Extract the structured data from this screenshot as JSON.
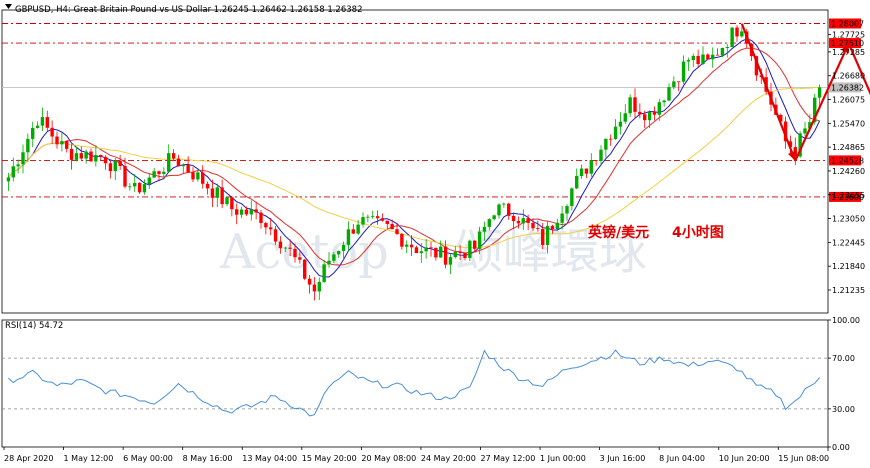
{
  "chart_data": [
    {
      "type": "candlestick",
      "title": "GBPUSD, H4: Great Britain Pound vs US Dollar",
      "ohlc_readout": [
        "1.26245",
        "1.26462",
        "1.26158",
        "1.26382"
      ],
      "ylim": [
        1.2065,
        1.2835
      ],
      "y_ticks": [
        "1.27725",
        "1.27285",
        "1.26680",
        "1.26075",
        "1.25470",
        "1.24865",
        "1.24260",
        "1.23655",
        "1.23050",
        "1.22445",
        "1.21840",
        "1.21235"
      ],
      "current_price": "1.26382",
      "levels": [
        {
          "label": "1.28007",
          "value": 1.28007
        },
        {
          "label": "1.27510",
          "value": 1.2751
        },
        {
          "label": "1.24528",
          "value": 1.24528
        },
        {
          "label": "1.23600",
          "value": 1.236
        }
      ],
      "x_labels": [
        "28 Apr 2020",
        "1 May 12:00",
        "6 May 00:00",
        "8 May 16:00",
        "13 May 04:00",
        "15 May 20:00",
        "20 May 08:00",
        "24 May 20:00",
        "27 May 12:00",
        "1 Jun 00:00",
        "3 Jun 16:00",
        "8 Jun 04:00",
        "10 Jun 20:00",
        "15 Jun 08:00"
      ],
      "anchors": [
        [
          0,
          1.241
        ],
        [
          6,
          1.256
        ],
        [
          12,
          1.2475
        ],
        [
          20,
          1.246
        ],
        [
          26,
          1.2375
        ],
        [
          34,
          1.246
        ],
        [
          40,
          1.24
        ],
        [
          46,
          1.233
        ],
        [
          52,
          1.231
        ],
        [
          58,
          1.222
        ],
        [
          63,
          1.212
        ],
        [
          66,
          1.22
        ],
        [
          72,
          1.23
        ],
        [
          78,
          1.228
        ],
        [
          84,
          1.223
        ],
        [
          90,
          1.221
        ],
        [
          96,
          1.223
        ],
        [
          100,
          1.233
        ],
        [
          104,
          1.232
        ],
        [
          110,
          1.225
        ],
        [
          116,
          1.238
        ],
        [
          122,
          1.249
        ],
        [
          128,
          1.26
        ],
        [
          132,
          1.257
        ],
        [
          136,
          1.264
        ],
        [
          140,
          1.271
        ],
        [
          144,
          1.27
        ],
        [
          148,
          1.276
        ],
        [
          151,
          1.28
        ],
        [
          154,
          1.269
        ],
        [
          157,
          1.26
        ],
        [
          160,
          1.25
        ],
        [
          162,
          1.248
        ],
        [
          165,
          1.255
        ],
        [
          167,
          1.2638
        ]
      ],
      "indicators": [
        {
          "name": "MA fast",
          "color": "#1a1acc"
        },
        {
          "name": "MA mid",
          "color": "#e03030"
        },
        {
          "name": "MA slow",
          "color": "#f0d040"
        }
      ],
      "annotation_arrows": {
        "color": "#e00000",
        "path": [
          [
            151,
            1.28
          ],
          [
            162,
            1.2452
          ],
          [
            173,
            1.275
          ],
          [
            186,
            1.238
          ]
        ]
      },
      "watermark": "Acetop",
      "watermark_cn": "颂峰環球",
      "annotation_text_cn": "英镑/美元",
      "annotation_text_num": "4小时图"
    },
    {
      "type": "line",
      "title": "RSI(14) 54.72",
      "ylim": [
        0,
        100
      ],
      "y_ticks": [
        "100.00",
        "70.00",
        "30.00",
        "0.00"
      ],
      "levels": [
        70,
        30
      ],
      "anchors": [
        [
          0,
          52
        ],
        [
          5,
          58
        ],
        [
          10,
          48
        ],
        [
          15,
          52
        ],
        [
          20,
          44
        ],
        [
          25,
          40
        ],
        [
          30,
          35
        ],
        [
          35,
          50
        ],
        [
          40,
          38
        ],
        [
          45,
          28
        ],
        [
          50,
          32
        ],
        [
          55,
          40
        ],
        [
          60,
          30
        ],
        [
          63,
          24
        ],
        [
          66,
          48
        ],
        [
          70,
          58
        ],
        [
          75,
          50
        ],
        [
          80,
          48
        ],
        [
          85,
          42
        ],
        [
          90,
          38
        ],
        [
          95,
          46
        ],
        [
          98,
          75
        ],
        [
          102,
          62
        ],
        [
          105,
          55
        ],
        [
          110,
          48
        ],
        [
          115,
          62
        ],
        [
          120,
          68
        ],
        [
          125,
          74
        ],
        [
          130,
          66
        ],
        [
          135,
          70
        ],
        [
          140,
          64
        ],
        [
          145,
          68
        ],
        [
          150,
          62
        ],
        [
          154,
          48
        ],
        [
          158,
          42
        ],
        [
          160,
          32
        ],
        [
          162,
          36
        ],
        [
          164,
          44
        ],
        [
          167,
          54.72
        ]
      ],
      "series_color": "#4a90d9"
    }
  ],
  "colors": {
    "background": "#ffffff",
    "grid_bull": "#00aa00",
    "bear": "#ff0000",
    "level_line": "#cc0000",
    "label_fill": "#ff0000",
    "current_price_label": "#c0c0c0"
  }
}
